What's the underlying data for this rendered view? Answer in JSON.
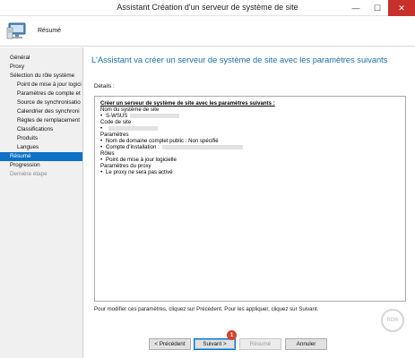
{
  "window": {
    "title": "Assistant Création d'un serveur de système de site",
    "minimize_glyph": "—",
    "maximize_glyph": "☐",
    "close_glyph": "✕"
  },
  "header": {
    "title": "Résumé",
    "icon": "server-computer-icon"
  },
  "sidebar": {
    "items": [
      {
        "label": "Général",
        "level": 0,
        "state": "normal"
      },
      {
        "label": "Proxy",
        "level": 0,
        "state": "normal"
      },
      {
        "label": "Sélection du rôle système",
        "level": 0,
        "state": "normal"
      },
      {
        "label": "Point de mise à jour logici",
        "level": 1,
        "state": "normal"
      },
      {
        "label": "Paramètres de compte et",
        "level": 1,
        "state": "normal"
      },
      {
        "label": "Source de synchronisatio",
        "level": 1,
        "state": "normal"
      },
      {
        "label": "Calendrier des synchroni",
        "level": 1,
        "state": "normal"
      },
      {
        "label": "Règles de remplacement",
        "level": 1,
        "state": "normal"
      },
      {
        "label": "Classifications",
        "level": 1,
        "state": "normal"
      },
      {
        "label": "Produits",
        "level": 1,
        "state": "normal"
      },
      {
        "label": "Langues",
        "level": 1,
        "state": "normal"
      },
      {
        "label": "Résumé",
        "level": 0,
        "state": "active"
      },
      {
        "label": "Progression",
        "level": 0,
        "state": "normal"
      },
      {
        "label": "Dernière étape",
        "level": 0,
        "state": "disabled"
      }
    ]
  },
  "main": {
    "heading": "L'Assistant va créer un serveur de système de site avec les paramètres suivants",
    "details_label": "Détails :",
    "details": {
      "summary_title": "Créer un serveur de système de site avec les paramètres suivants :",
      "site_system_name_label": "Nom du système de site",
      "site_system_name_value": "S-WSUS",
      "site_code_label": "Code de site",
      "parameters_label": "Paramètres",
      "fqdn_line": "Nom de domaine complet public : Non spécifié",
      "install_account_line": "Compte d'installation :",
      "roles_label": "Rôles",
      "role_line": "Point de mise à jour logicielle",
      "proxy_params_label": "Paramètres du proxy",
      "proxy_line": "Le proxy ne sera pas activé"
    },
    "footer_note": "Pour modifier ces paramètres, cliquez sur Précédent. Pour les appliquer, cliquez sur Suivant."
  },
  "buttons": {
    "previous": "< Précédent",
    "next": "Suivant >",
    "summary": "Résumé",
    "cancel": "Annuler"
  },
  "annotation_badge": "1",
  "watermark_text": "RDR",
  "colors": {
    "accent": "#0b72c6",
    "heading": "#1c6ea7",
    "close_button": "#c7312b",
    "badge": "#d9412d"
  }
}
